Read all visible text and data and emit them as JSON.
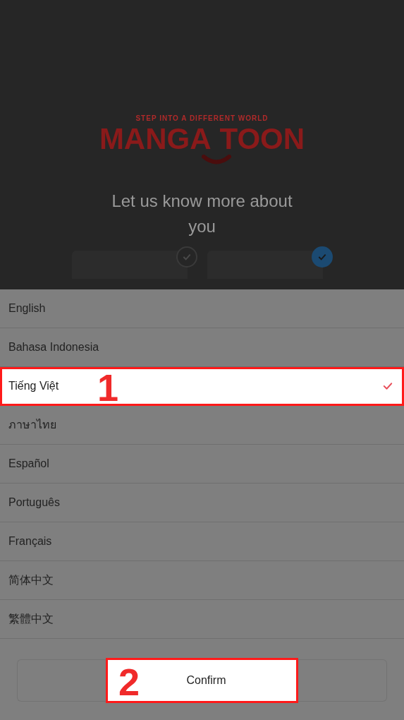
{
  "header": {
    "tagline": "STEP INTO A DIFFERENT WORLD",
    "logo_left": "MANGA",
    "logo_right": "TOON",
    "title": "Let us know more about you"
  },
  "cards": [
    {
      "checked": false
    },
    {
      "checked": true
    }
  ],
  "languages": [
    {
      "label": "English",
      "selected": false
    },
    {
      "label": "Bahasa Indonesia",
      "selected": false
    },
    {
      "label": "Tiếng Việt",
      "selected": true
    },
    {
      "label": "ภาษาไทย",
      "selected": false
    },
    {
      "label": "Español",
      "selected": false
    },
    {
      "label": "Português",
      "selected": false
    },
    {
      "label": "Français",
      "selected": false
    },
    {
      "label": "简体中文",
      "selected": false
    },
    {
      "label": "繁體中文",
      "selected": false
    }
  ],
  "confirm": {
    "label": "Confirm"
  },
  "annotations": [
    "1",
    "2"
  ]
}
